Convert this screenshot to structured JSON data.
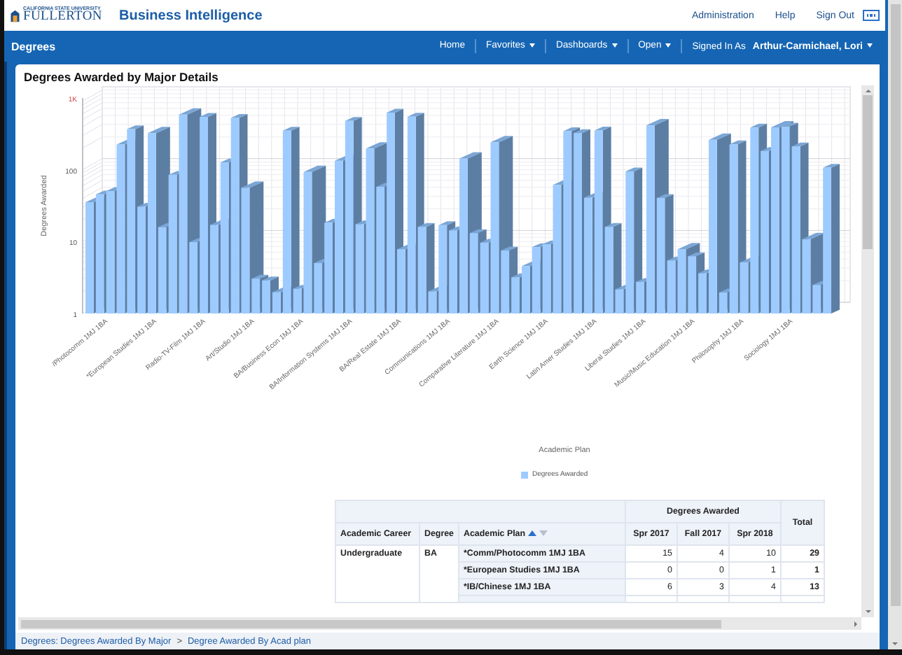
{
  "header": {
    "logo": {
      "line1": "CALIFORNIA STATE UNIVERSITY",
      "line2": "FULLERTON"
    },
    "title": "Business Intelligence",
    "links": [
      "Administration",
      "Help",
      "Sign Out"
    ]
  },
  "navbar": {
    "title": "Degrees",
    "items": [
      {
        "label": "Home",
        "dropdown": false
      },
      {
        "label": "Favorites",
        "dropdown": true
      },
      {
        "label": "Dashboards",
        "dropdown": true
      },
      {
        "label": "Open",
        "dropdown": true
      }
    ],
    "signed_in_label": "Signed In As",
    "user": "Arthur-Carmichael, Lori"
  },
  "panel": {
    "title": "Degrees Awarded by Major Details",
    "chart": {
      "y_axis_title": "Degrees Awarded",
      "y_ticks": [
        "1K",
        "100",
        "10",
        "1"
      ],
      "x_axis_title": "Academic Plan",
      "x_labels": [
        "/Photocomm 1MJ 1BA",
        "*European Studies 1MJ 1BA",
        "Radio-TV-Film 1MJ 1BA",
        "Art/Studio 1MJ 1BA",
        "BA/Business Econ 1MJ 1BA",
        "BA/Information Systems 1MJ 1BA",
        "BA/Real Estate 1MJ 1BA",
        "Communications 1MJ 1BA",
        "Comparative Literature 1MJ 1BA",
        "Earth Science 1MJ 1BA",
        "Latin Amer Studies 1MJ 1BA",
        "Liberal Studies 1MJ 1BA",
        "Music/Music Education 1MJ 1BA",
        "Philosophy 1MJ 1BA",
        "Sociology 1MJ 1BA"
      ],
      "legend": [
        "Degrees Awarded"
      ]
    },
    "table": {
      "group_header": "Degrees Awarded",
      "total_header": "Total",
      "columns": [
        {
          "label": "Academic Career"
        },
        {
          "label": "Degree"
        },
        {
          "label": "Academic Plan",
          "sort_ascending": true
        },
        {
          "label": "Spr 2017"
        },
        {
          "label": "Fall 2017"
        },
        {
          "label": "Spr 2018"
        }
      ],
      "career": "Undergraduate",
      "degree": "BA",
      "rows": [
        {
          "plan": "*Comm/Photocomm 1MJ 1BA",
          "values": [
            "15",
            "4",
            "10"
          ],
          "total": "29"
        },
        {
          "plan": "*European Studies 1MJ 1BA",
          "values": [
            "0",
            "0",
            "1"
          ],
          "total": "1"
        },
        {
          "plan": "*IB/Chinese 1MJ 1BA",
          "values": [
            "6",
            "3",
            "4"
          ],
          "total": "13"
        }
      ]
    }
  },
  "breadcrumb": {
    "items": [
      "Degrees: Degrees Awarded By Major",
      "Degree Awarded By Acad plan"
    ],
    "separator": ">"
  }
}
